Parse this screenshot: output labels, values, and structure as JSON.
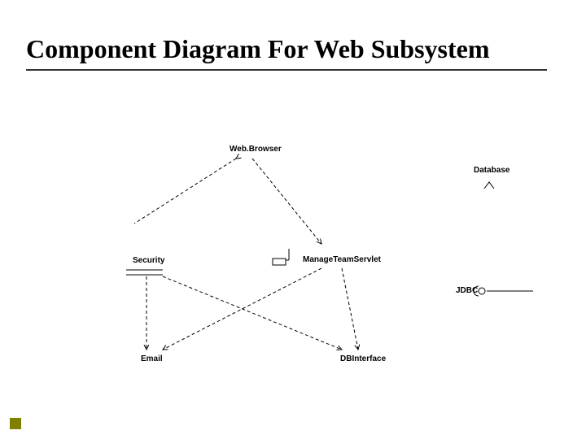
{
  "title": "Component Diagram For Web Subsystem",
  "nodes": {
    "webBrowser": "Web.Browser",
    "database": "Database",
    "security": "Security",
    "manageTeam": "ManageTeamServlet",
    "jdbc": "JDBC",
    "email": "Email",
    "dbInterface": "DBInterface"
  }
}
